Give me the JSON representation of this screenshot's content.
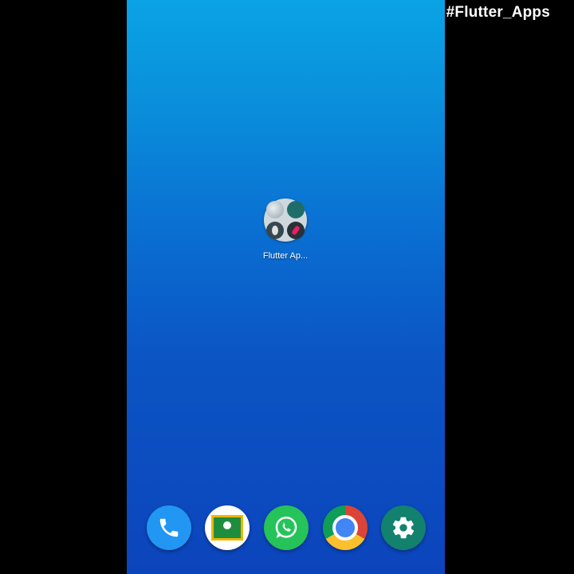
{
  "overlay": {
    "hashtag": "#Flutter_Apps"
  },
  "home": {
    "folder": {
      "label": "Flutter Ap..."
    },
    "dock": [
      {
        "app": "Phone",
        "icon": "phone-icon"
      },
      {
        "app": "Google Classroom",
        "icon": "classroom-icon"
      },
      {
        "app": "WhatsApp",
        "icon": "whatsapp-icon"
      },
      {
        "app": "Chrome",
        "icon": "chrome-icon"
      },
      {
        "app": "Settings",
        "icon": "gear-icon"
      }
    ]
  },
  "colors": {
    "wallpaper_top": "#0aa3e4",
    "wallpaper_bottom": "#0c44bc",
    "letterbox": "#000000",
    "phone": "#2196f3",
    "whatsapp": "#25c35a",
    "settings": "#12816e"
  }
}
